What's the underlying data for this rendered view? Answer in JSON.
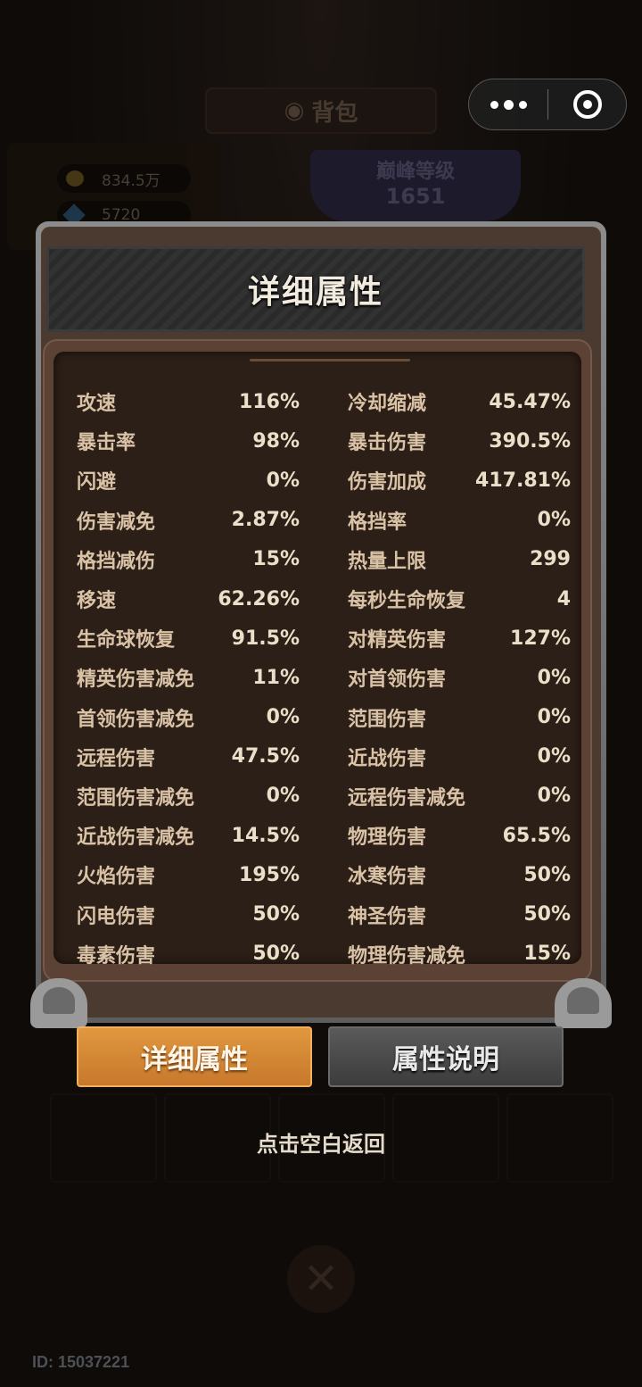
{
  "background": {
    "bag_title": "背包",
    "gold": "834.5万",
    "gems": "5720",
    "peak_level_label": "巅峰等级",
    "peak_level_value": "1651"
  },
  "panel": {
    "title": "详细属性",
    "stats_left": [
      {
        "label": "攻速",
        "value": "116%"
      },
      {
        "label": "暴击率",
        "value": "98%"
      },
      {
        "label": "闪避",
        "value": "0%"
      },
      {
        "label": "伤害减免",
        "value": "2.87%"
      },
      {
        "label": "格挡减伤",
        "value": "15%"
      },
      {
        "label": "移速",
        "value": "62.26%"
      },
      {
        "label": "生命球恢复",
        "value": "91.5%"
      },
      {
        "label": "精英伤害减免",
        "value": "11%"
      },
      {
        "label": "首领伤害减免",
        "value": "0%"
      },
      {
        "label": "远程伤害",
        "value": "47.5%"
      },
      {
        "label": "范围伤害减免",
        "value": "0%"
      },
      {
        "label": "近战伤害减免",
        "value": "14.5%"
      },
      {
        "label": "火焰伤害",
        "value": "195%"
      },
      {
        "label": "闪电伤害",
        "value": "50%"
      },
      {
        "label": "毒素伤害",
        "value": "50%"
      }
    ],
    "stats_right": [
      {
        "label": "冷却缩减",
        "value": "45.47%"
      },
      {
        "label": "暴击伤害",
        "value": "390.5%"
      },
      {
        "label": "伤害加成",
        "value": "417.81%"
      },
      {
        "label": "格挡率",
        "value": "0%"
      },
      {
        "label": "热量上限",
        "value": "299"
      },
      {
        "label": "每秒生命恢复",
        "value": "4"
      },
      {
        "label": "对精英伤害",
        "value": "127%"
      },
      {
        "label": "对首领伤害",
        "value": "0%"
      },
      {
        "label": "范围伤害",
        "value": "0%"
      },
      {
        "label": "近战伤害",
        "value": "0%"
      },
      {
        "label": "远程伤害减免",
        "value": "0%"
      },
      {
        "label": "物理伤害",
        "value": "65.5%"
      },
      {
        "label": "冰寒伤害",
        "value": "50%"
      },
      {
        "label": "神圣伤害",
        "value": "50%"
      },
      {
        "label": "物理伤害减免",
        "value": "15%"
      }
    ]
  },
  "tabs": {
    "details": "详细属性",
    "explain": "属性说明"
  },
  "hint": "点击空白返回",
  "user_id": "ID: 15037221"
}
